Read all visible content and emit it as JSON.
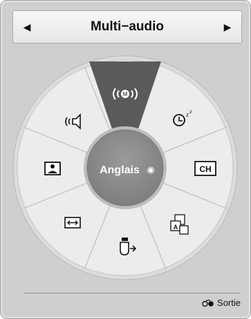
{
  "header": {
    "title": "Multi−audio",
    "prev_arrow": "◀",
    "next_arrow": "▶"
  },
  "center": {
    "language_label": "Anglais",
    "selected_marker": "◉"
  },
  "wheel": {
    "items": [
      {
        "id": "multi-audio",
        "icon": "multi-audio-icon",
        "active": true,
        "glyph": "M"
      },
      {
        "id": "sleep-timer",
        "icon": "sleep-timer-icon",
        "active": false,
        "glyph": "z z"
      },
      {
        "id": "channel",
        "icon": "channel-icon",
        "active": false,
        "glyph": "CH"
      },
      {
        "id": "subtitle",
        "icon": "subtitle-icon",
        "active": false,
        "glyph": "A"
      },
      {
        "id": "input",
        "icon": "input-icon",
        "active": false
      },
      {
        "id": "aspect-ratio",
        "icon": "aspect-ratio-icon",
        "active": false
      },
      {
        "id": "picture-mode",
        "icon": "picture-mode-icon",
        "active": false
      },
      {
        "id": "sound-mode",
        "icon": "sound-mode-icon",
        "active": false
      }
    ]
  },
  "footer": {
    "exit_label": "Sortie",
    "exit_icon": "exit-icon"
  },
  "colors": {
    "panel": "#cfcfcf",
    "wheel": "#e9e9e9",
    "active_sector": "#555555",
    "hub": "#8c8c8c",
    "text_light": "#ffffff"
  }
}
